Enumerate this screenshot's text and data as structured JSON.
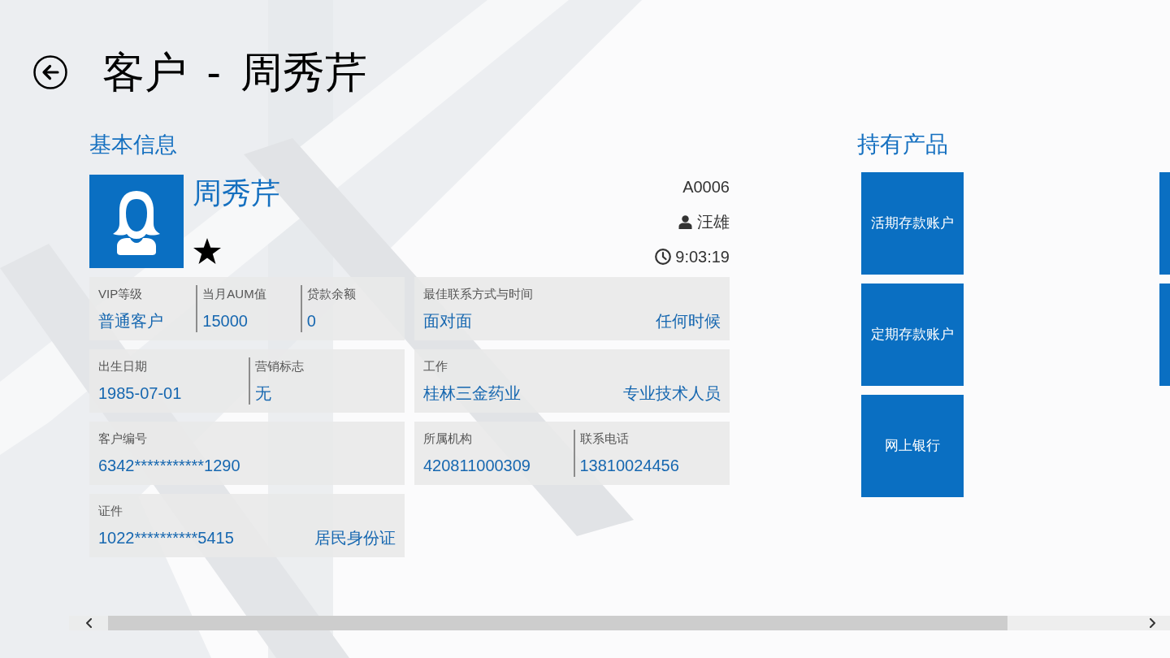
{
  "page": {
    "title": "客户 - 周秀芹"
  },
  "basic_info": {
    "heading": "基本信息",
    "customer_name": "周秀芹",
    "starred": true,
    "code": "A0006",
    "manager": "汪雄",
    "time": "9:03:19",
    "cards": [
      {
        "kind": "columns",
        "fields": [
          {
            "label": "VIP等级",
            "value": "普通客户"
          },
          {
            "label": "当月AUM值",
            "value": "15000"
          },
          {
            "label": "贷款余额",
            "value": "0"
          }
        ]
      },
      {
        "kind": "pair",
        "label": "最佳联系方式与时间",
        "value": "面对面",
        "value_right": "任何时候"
      },
      {
        "kind": "columns",
        "fields": [
          {
            "label": "出生日期",
            "value": "1985-07-01"
          },
          {
            "label": "营销标志",
            "value": "无"
          }
        ]
      },
      {
        "kind": "pair",
        "label": "工作",
        "value": "桂林三金药业",
        "value_right": "专业技术人员"
      },
      {
        "kind": "columns",
        "fields": [
          {
            "label": "客户编号",
            "value": "6342***********1290"
          }
        ]
      },
      {
        "kind": "columns",
        "fields": [
          {
            "label": "所属机构",
            "value": "420811000309"
          },
          {
            "label": "联系电话",
            "value": "13810024456"
          }
        ]
      },
      {
        "kind": "pair",
        "label": "证件",
        "value": "1022**********5415",
        "value_right": "居民身份证"
      }
    ]
  },
  "held_products": {
    "heading": "持有产品",
    "items": [
      {
        "label": "活期存款账户"
      },
      {
        "label": "定期存款账户"
      },
      {
        "label": "网上银行"
      }
    ]
  }
}
